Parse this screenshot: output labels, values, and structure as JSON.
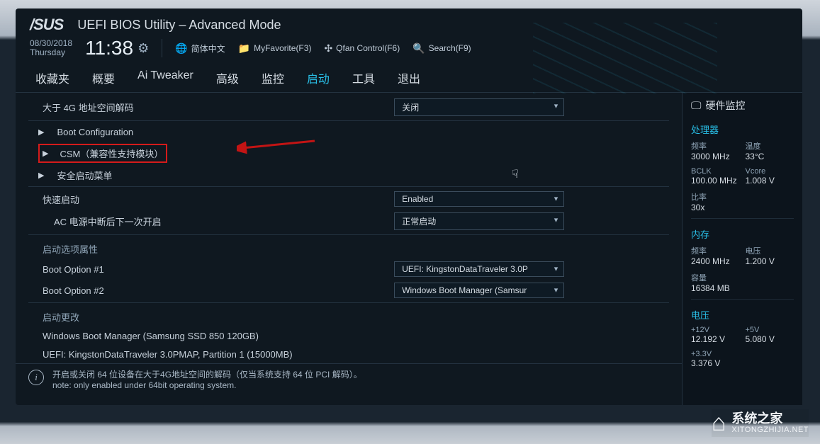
{
  "header": {
    "brand": "/SUS",
    "title": "UEFI BIOS Utility – Advanced Mode",
    "date": "08/30/2018",
    "day": "Thursday",
    "time": "11:38",
    "quick": {
      "lang": "简体中文",
      "fav": "MyFavorite(F3)",
      "qfan": "Qfan Control(F6)",
      "search": "Search(F9)"
    }
  },
  "tabs": [
    "收藏夹",
    "概要",
    "Ai Tweaker",
    "高级",
    "监控",
    "启动",
    "工具",
    "退出"
  ],
  "active_tab": "启动",
  "settings": {
    "above4g": {
      "label": "大于 4G 地址空间解码",
      "value": "关闭"
    },
    "bootcfg": "Boot Configuration",
    "csm": "CSM（兼容性支持模块）",
    "secure": "安全启动菜单",
    "fastboot": {
      "label": "快速启动",
      "value": "Enabled"
    },
    "acrecover": {
      "label": "AC 电源中断后下一次开启",
      "value": "正常启动"
    },
    "bootoptprop": "启动选项属性",
    "boot1": {
      "label": "Boot Option #1",
      "value": "UEFI: KingstonDataTraveler 3.0P"
    },
    "boot2": {
      "label": "Boot Option #2",
      "value": "Windows Boot Manager (Samsur"
    },
    "bootchange": "启动更改",
    "bc1": "Windows Boot Manager (Samsung SSD 850 120GB)",
    "bc2": "UEFI: KingstonDataTraveler 3.0PMAP, Partition 1 (15000MB)"
  },
  "info": {
    "line1": "开启或关闭 64 位设备在大于4G地址空间的解码（仅当系统支持 64 位 PCI 解码）。",
    "line2": "note: only enabled under 64bit operating system."
  },
  "hw": {
    "title": "硬件监控",
    "cpu": {
      "section": "处理器",
      "freq_l": "频率",
      "freq_v": "3000 MHz",
      "temp_l": "温度",
      "temp_v": "33°C",
      "bclk_l": "BCLK",
      "bclk_v": "100.00 MHz",
      "vcore_l": "Vcore",
      "vcore_v": "1.008 V",
      "ratio_l": "比率",
      "ratio_v": "30x"
    },
    "mem": {
      "section": "内存",
      "freq_l": "频率",
      "freq_v": "2400 MHz",
      "volt_l": "电压",
      "volt_v": "1.200 V",
      "cap_l": "容量",
      "cap_v": "16384 MB"
    },
    "volt": {
      "section": "电压",
      "p12_l": "+12V",
      "p12_v": "12.192 V",
      "p5_l": "+5V",
      "p5_v": "5.080 V",
      "p33_l": "+3.3V",
      "p33_v": "3.376 V"
    }
  },
  "watermark": {
    "cn": "系统之家",
    "url": "XITONGZHIJIA.NET"
  }
}
